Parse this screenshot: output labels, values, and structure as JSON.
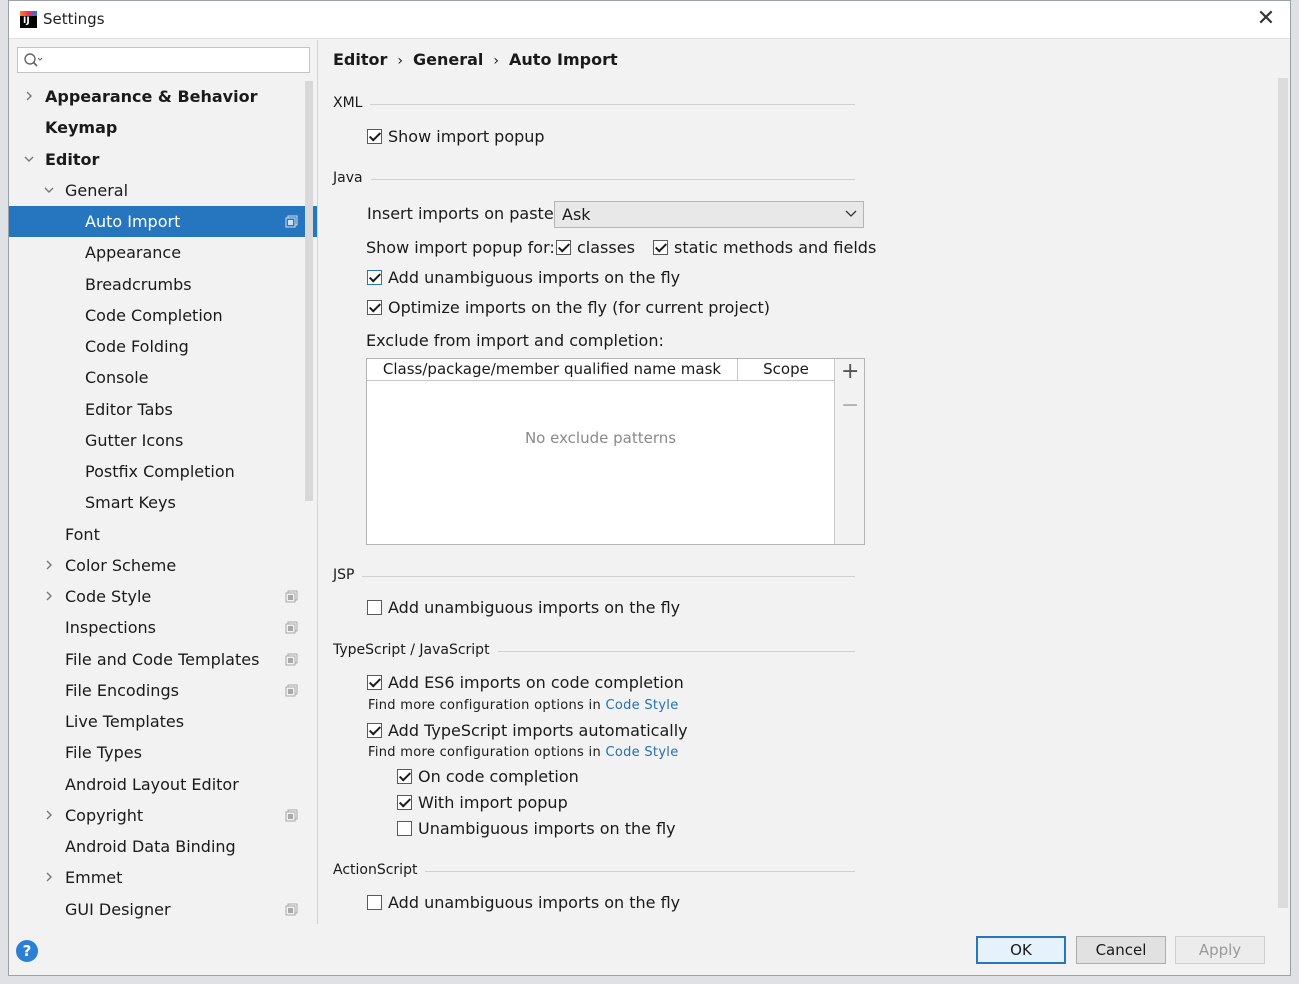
{
  "window": {
    "title": "Settings"
  },
  "search": {
    "placeholder": ""
  },
  "tree": [
    {
      "label": "Appearance & Behavior",
      "level": 0,
      "arrow": "right",
      "bold": true,
      "icon": false,
      "selected": false
    },
    {
      "label": "Keymap",
      "level": 0,
      "arrow": "none",
      "bold": true,
      "icon": false,
      "selected": false
    },
    {
      "label": "Editor",
      "level": 0,
      "arrow": "down",
      "bold": true,
      "icon": false,
      "selected": false
    },
    {
      "label": "General",
      "level": 1,
      "arrow": "down",
      "bold": false,
      "icon": false,
      "selected": false
    },
    {
      "label": "Auto Import",
      "level": 2,
      "arrow": "none",
      "bold": false,
      "icon": true,
      "selected": true
    },
    {
      "label": "Appearance",
      "level": 2,
      "arrow": "none",
      "bold": false,
      "icon": false,
      "selected": false
    },
    {
      "label": "Breadcrumbs",
      "level": 2,
      "arrow": "none",
      "bold": false,
      "icon": false,
      "selected": false
    },
    {
      "label": "Code Completion",
      "level": 2,
      "arrow": "none",
      "bold": false,
      "icon": false,
      "selected": false
    },
    {
      "label": "Code Folding",
      "level": 2,
      "arrow": "none",
      "bold": false,
      "icon": false,
      "selected": false
    },
    {
      "label": "Console",
      "level": 2,
      "arrow": "none",
      "bold": false,
      "icon": false,
      "selected": false
    },
    {
      "label": "Editor Tabs",
      "level": 2,
      "arrow": "none",
      "bold": false,
      "icon": false,
      "selected": false
    },
    {
      "label": "Gutter Icons",
      "level": 2,
      "arrow": "none",
      "bold": false,
      "icon": false,
      "selected": false
    },
    {
      "label": "Postfix Completion",
      "level": 2,
      "arrow": "none",
      "bold": false,
      "icon": false,
      "selected": false
    },
    {
      "label": "Smart Keys",
      "level": 2,
      "arrow": "none",
      "bold": false,
      "icon": false,
      "selected": false
    },
    {
      "label": "Font",
      "level": 1,
      "arrow": "none",
      "bold": false,
      "icon": false,
      "selected": false
    },
    {
      "label": "Color Scheme",
      "level": 1,
      "arrow": "right",
      "bold": false,
      "icon": false,
      "selected": false
    },
    {
      "label": "Code Style",
      "level": 1,
      "arrow": "right",
      "bold": false,
      "icon": true,
      "selected": false
    },
    {
      "label": "Inspections",
      "level": 1,
      "arrow": "none",
      "bold": false,
      "icon": true,
      "selected": false
    },
    {
      "label": "File and Code Templates",
      "level": 1,
      "arrow": "none",
      "bold": false,
      "icon": true,
      "selected": false
    },
    {
      "label": "File Encodings",
      "level": 1,
      "arrow": "none",
      "bold": false,
      "icon": true,
      "selected": false
    },
    {
      "label": "Live Templates",
      "level": 1,
      "arrow": "none",
      "bold": false,
      "icon": false,
      "selected": false
    },
    {
      "label": "File Types",
      "level": 1,
      "arrow": "none",
      "bold": false,
      "icon": false,
      "selected": false
    },
    {
      "label": "Android Layout Editor",
      "level": 1,
      "arrow": "none",
      "bold": false,
      "icon": false,
      "selected": false
    },
    {
      "label": "Copyright",
      "level": 1,
      "arrow": "right",
      "bold": false,
      "icon": true,
      "selected": false
    },
    {
      "label": "Android Data Binding",
      "level": 1,
      "arrow": "none",
      "bold": false,
      "icon": false,
      "selected": false
    },
    {
      "label": "Emmet",
      "level": 1,
      "arrow": "right",
      "bold": false,
      "icon": false,
      "selected": false
    },
    {
      "label": "GUI Designer",
      "level": 1,
      "arrow": "none",
      "bold": false,
      "icon": true,
      "selected": false
    }
  ],
  "breadcrumb": {
    "items": [
      "Editor",
      "General",
      "Auto Import"
    ],
    "separator": "›"
  },
  "xml": {
    "title": "XML",
    "show_import_popup": {
      "label": "Show import popup",
      "checked": true
    }
  },
  "java": {
    "title": "Java",
    "insert_label": "Insert imports on paste:",
    "insert_value": "Ask",
    "popup_for_label": "Show import popup for:",
    "classes": {
      "label": "classes",
      "checked": true
    },
    "static_methods": {
      "label": "static methods and fields",
      "checked": true
    },
    "add_unambiguous": {
      "label": "Add unambiguous imports on the fly",
      "checked": true
    },
    "optimize": {
      "label": "Optimize imports on the fly (for current project)",
      "checked": true
    },
    "exclude_label": "Exclude from import and completion:",
    "table": {
      "columns": [
        "Class/package/member qualified name mask",
        "Scope"
      ],
      "empty_text": "No exclude patterns",
      "add": "+",
      "remove": "−"
    }
  },
  "jsp": {
    "title": "JSP",
    "add_unambiguous": {
      "label": "Add unambiguous imports on the fly",
      "checked": false
    }
  },
  "ts": {
    "title": "TypeScript / JavaScript",
    "es6": {
      "label": "Add ES6 imports on code completion",
      "checked": true
    },
    "find_more_1": "Find more configuration options in",
    "code_style_1": "Code Style",
    "ts_auto": {
      "label": "Add TypeScript imports automatically",
      "checked": true
    },
    "find_more_2": "Find more configuration options in",
    "code_style_2": "Code Style",
    "on_completion": {
      "label": "On code completion",
      "checked": true
    },
    "with_popup": {
      "label": "With import popup",
      "checked": true
    },
    "unambiguous": {
      "label": "Unambiguous imports on the fly",
      "checked": false
    }
  },
  "actionscript": {
    "title": "ActionScript",
    "add_unambiguous": {
      "label": "Add unambiguous imports on the fly",
      "checked": false
    }
  },
  "buttons": {
    "ok": "OK",
    "cancel": "Cancel",
    "apply": "Apply",
    "help": "?"
  },
  "colors": {
    "selection": "#2675bf",
    "link": "#2470b3",
    "background": "#f2f2f2"
  }
}
